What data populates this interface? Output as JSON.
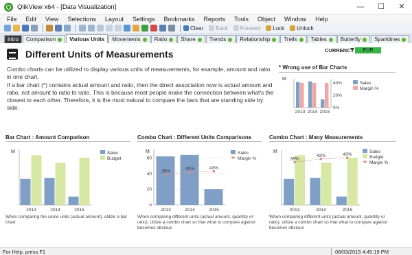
{
  "window": {
    "title": "QlikView x64 - [Data Visualization]",
    "controls": [
      "—",
      "☐",
      "✕"
    ]
  },
  "menu": [
    "File",
    "Edit",
    "View",
    "Selections",
    "Layout",
    "Settings",
    "Bookmarks",
    "Reports",
    "Tools",
    "Object",
    "Window",
    "Help"
  ],
  "toolbar": {
    "clear": "Clear",
    "back": "Back",
    "forward": "Forward",
    "lock": "Lock",
    "unlock": "Unlock"
  },
  "tabs": [
    "Intro",
    "Comparison",
    "Various Units",
    "Movements",
    "Ratio",
    "Share",
    "Trends",
    "Relationship",
    "Trells",
    "Tables",
    "Butterfly",
    "Sparklines"
  ],
  "sheet": {
    "heading": "Different Units of Measurements",
    "currency_label": "CURRENCY",
    "currency_value": "EUR",
    "paragraph1": "Combo charts can be utilized to display various units of measurements, for example, amount and ratio in one chart.",
    "paragraph2": "If a bar chart (*) contains actual amount and ratio, then the direct association now is actual amount and ratio, not amount to ratio to ratio. This is because most people make the connection between what's the closest to each other. Therefore, it is the most natural to compare the bars that are standing side by side.",
    "wrong_title": "* Wrong use of Bar Charts",
    "chart1_title": "Bar Chart : Amount Comparison",
    "chart2_title": "Combo Chart : Different Units Comparisons",
    "chart3_title": "Combo Chart : Many Measurements",
    "note1": "When comparing the same units (actual amount), utilize a bar chart",
    "note2": "When comparing different units (actual amount, quantity or ratio), utilize a combo chart so that what to compare against becomes obvious",
    "note3": "When comparing different units (actual amount, quantity or ratio), utilize a combo chart so that what to compare against becomes obvious"
  },
  "status": {
    "help": "For Help, press F1",
    "datetime": "08/03/2015 4:45:19 PM"
  },
  "colors": {
    "sales": "#7f9fc6",
    "budget": "#d6e8a4",
    "margin_bar": "#f4a6a6",
    "margin_line": "#e08a8a"
  },
  "chart_data": [
    {
      "type": "bar",
      "title": "* Wrong use of Bar Charts",
      "ylabel": "M",
      "categories": [
        "2013",
        "2014",
        "2015"
      ],
      "series": [
        {
          "name": "Sales",
          "values": [
            62,
            64,
            20
          ],
          "axis": "left"
        },
        {
          "name": "Margin %",
          "values": [
            40,
            40,
            40
          ],
          "axis": "right"
        }
      ],
      "ylim_right": [
        0,
        40
      ],
      "right_ticks": [
        "0%",
        "20%",
        "40%"
      ],
      "legend": "right"
    },
    {
      "type": "bar",
      "title": "Bar Chart : Amount Comparison",
      "ylabel": "M",
      "categories": [
        "2013",
        "2014",
        "2015"
      ],
      "series": [
        {
          "name": "Sales",
          "values": [
            62,
            64,
            20
          ]
        },
        {
          "name": "Budget",
          "values": [
            118,
            100,
            112
          ]
        }
      ],
      "ylim": [
        0,
        130
      ],
      "legend": "top-right"
    },
    {
      "type": "bar",
      "title": "Combo Chart : Different Units Comparisons",
      "ylabel": "M",
      "categories": [
        "2013",
        "2014",
        "2015"
      ],
      "series": [
        {
          "name": "Sales",
          "values": [
            62,
            64,
            20
          ],
          "kind": "bar"
        },
        {
          "name": "Margin %",
          "values": [
            39,
            42,
            43
          ],
          "kind": "line",
          "labels": [
            "39%",
            "42%",
            "43%"
          ]
        }
      ],
      "y_ticks": [
        "0",
        "20",
        "40",
        "60"
      ],
      "ylim": [
        0,
        70
      ],
      "legend": "top-right"
    },
    {
      "type": "bar",
      "title": "Combo Chart : Many Measurements",
      "ylabel": "M",
      "categories": [
        "2013",
        "2014",
        "2015"
      ],
      "series": [
        {
          "name": "Sales",
          "values": [
            62,
            64,
            20
          ],
          "kind": "bar"
        },
        {
          "name": "Budget",
          "values": [
            118,
            100,
            112
          ],
          "kind": "bar"
        },
        {
          "name": "Margin %",
          "values": [
            39,
            42,
            43
          ],
          "kind": "line",
          "labels": [
            "39%",
            "42%",
            "43%"
          ]
        }
      ],
      "ylim": [
        0,
        130
      ],
      "legend": "top-right"
    }
  ]
}
